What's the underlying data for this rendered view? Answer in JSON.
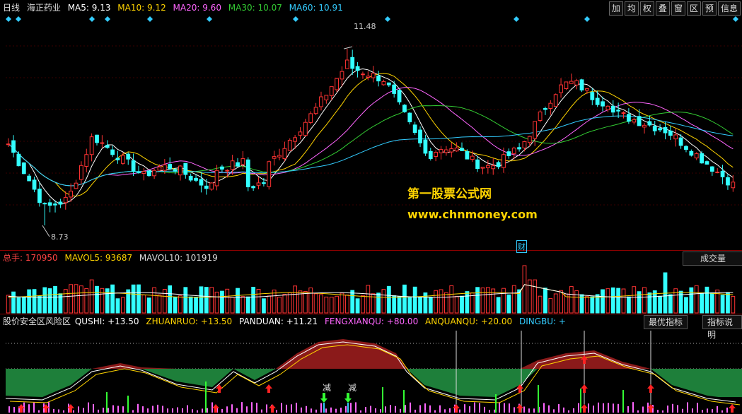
{
  "header": {
    "period": "日线",
    "stock_name": "海正药业",
    "ma": [
      {
        "label": "MA5: 9.13",
        "color": "#ffffff"
      },
      {
        "label": "MA10: 9.12",
        "color": "#ffd400"
      },
      {
        "label": "MA20: 9.60",
        "color": "#ff66ff"
      },
      {
        "label": "MA30: 10.07",
        "color": "#33cc33"
      },
      {
        "label": "MA60: 10.91",
        "color": "#33ccff"
      }
    ],
    "buttons": [
      "加",
      "均",
      "权",
      "叠",
      "窗",
      "区",
      "预",
      "信息"
    ]
  },
  "price_labels": {
    "high": "11.48",
    "low": "8.73",
    "cai": "财"
  },
  "volume": {
    "label_total": "总手: 170950",
    "label_mavol5": "MAVOL5: 93687",
    "label_mavol10": "MAVOL10: 101919",
    "button": "成交量"
  },
  "indicator": {
    "name": "股价安全区风险区",
    "items": [
      {
        "label": "QUSHI: +13.50",
        "color": "#ffffff"
      },
      {
        "label": "ZHUANRUO: +13.50",
        "color": "#ffd400"
      },
      {
        "label": "PANDUAN: +11.21",
        "color": "#ffffff"
      },
      {
        "label": "FENGXIANQU: +80.00",
        "color": "#ff66ff"
      },
      {
        "label": "ANQUANQU: +20.00",
        "color": "#ffd400"
      },
      {
        "label": "DINGBU: +",
        "color": "#33ccff"
      }
    ],
    "buttons": [
      "最优指标",
      "指标说明"
    ],
    "jian_label": "减"
  },
  "watermark": {
    "line1": "第一股票公式网",
    "line2": "www.chnmoney.com"
  },
  "chart_data": {
    "type": "candlestick",
    "title": "海正药业 日线",
    "price_range": [
      8.5,
      11.8
    ],
    "high_mark": 11.48,
    "low_mark": 8.73,
    "ma_latest": {
      "MA5": 9.13,
      "MA10": 9.12,
      "MA20": 9.6,
      "MA30": 10.07,
      "MA60": 10.91
    },
    "volume_latest": 170950,
    "mavol5": 93687,
    "mavol10": 101919,
    "indicator_latest": {
      "QUSHI": 13.5,
      "ZHUANRUO": 13.5,
      "PANDUAN": 11.21,
      "FENGXIANQU": 80.0,
      "ANQUANQU": 20.0
    }
  }
}
